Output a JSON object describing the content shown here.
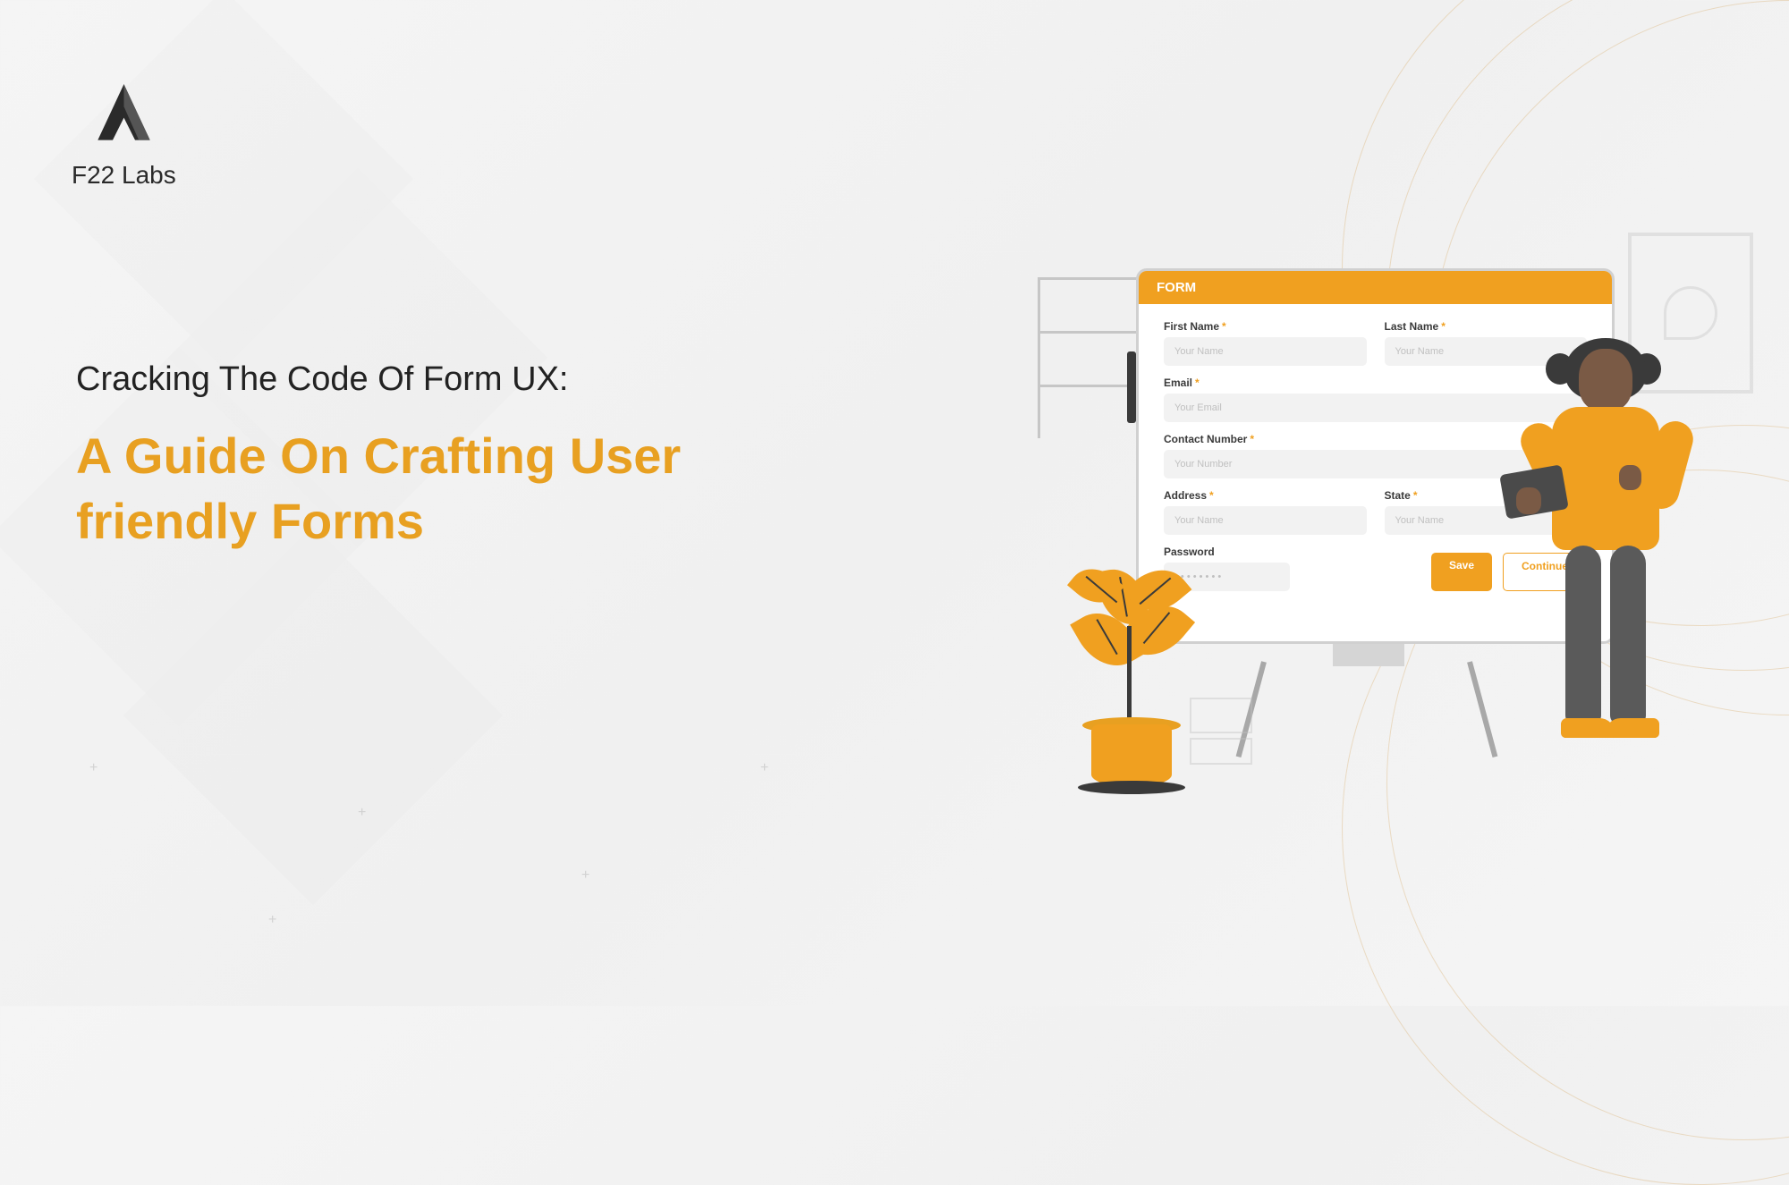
{
  "brand": {
    "name": "F22 Labs"
  },
  "heading": {
    "small": "Cracking The Code Of Form UX:",
    "large": "A Guide On Crafting User friendly Forms"
  },
  "form": {
    "title": "FORM",
    "fields": {
      "firstName": {
        "label": "First Name",
        "placeholder": "Your Name"
      },
      "lastName": {
        "label": "Last Name",
        "placeholder": "Your Name"
      },
      "email": {
        "label": "Email",
        "placeholder": "Your Email"
      },
      "contact": {
        "label": "Contact Number",
        "placeholder": "Your Number"
      },
      "address": {
        "label": "Address",
        "placeholder": "Your Name"
      },
      "state": {
        "label": "State",
        "placeholder": "Your Name"
      },
      "password": {
        "label": "Password",
        "placeholder": "• • • • • • • •"
      }
    },
    "actions": {
      "save": "Save",
      "continue": "Continue"
    }
  },
  "colors": {
    "accent": "#f0a020",
    "text": "#222222"
  }
}
